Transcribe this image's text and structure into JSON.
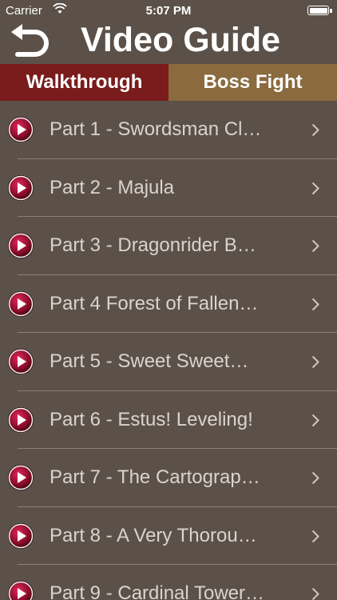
{
  "status": {
    "carrier": "Carrier",
    "time": "5:07 PM"
  },
  "nav": {
    "title": "Video Guide",
    "back_icon": "back-arrow-icon"
  },
  "tabs": [
    {
      "label": "Walkthrough",
      "selected": true,
      "color": "#7a1c1c"
    },
    {
      "label": "Boss Fight",
      "selected": false,
      "color": "#8a6a3e"
    }
  ],
  "items": [
    {
      "label": "Part 1 - Swordsman Cl…"
    },
    {
      "label": "Part 2 - Majula"
    },
    {
      "label": "Part 3 - Dragonrider B…"
    },
    {
      "label": "Part 4 Forest of Fallen…"
    },
    {
      "label": "Part 5 - Sweet Sweet…"
    },
    {
      "label": "Part 6 - Estus! Leveling!"
    },
    {
      "label": "Part 7 - The Cartograp…"
    },
    {
      "label": "Part 8 - A Very Thorou…"
    },
    {
      "label": "Part 9 - Cardinal Tower…"
    }
  ],
  "colors": {
    "background": "#5b5148",
    "accent_red": "#7a1c1c",
    "accent_gold": "#8a6a3e"
  }
}
